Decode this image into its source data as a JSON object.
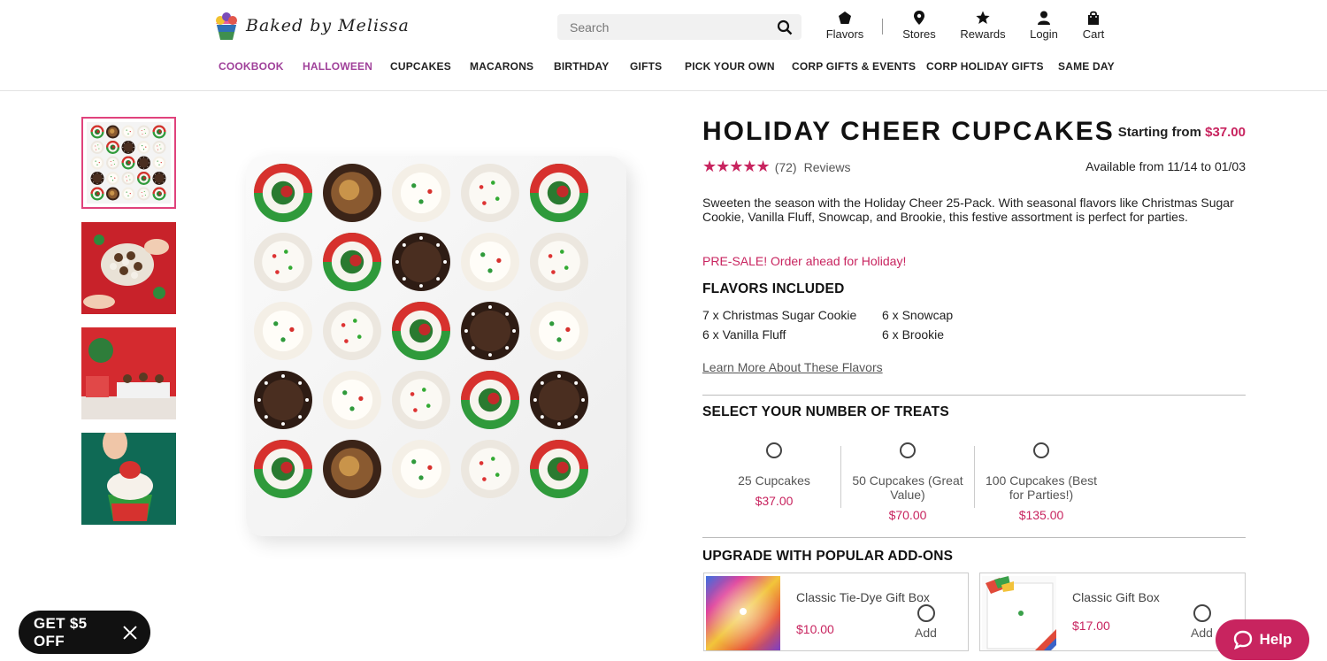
{
  "header": {
    "logo_text": "Baked by Melissa",
    "search_placeholder": "Search",
    "nav": [
      {
        "label": "Flavors",
        "icon": "flavors-icon"
      },
      {
        "label": "Stores",
        "icon": "map-pin-icon"
      },
      {
        "label": "Rewards",
        "icon": "star-icon"
      },
      {
        "label": "Login",
        "icon": "user-icon"
      },
      {
        "label": "Cart",
        "icon": "shopping-bag-icon"
      }
    ],
    "categories": [
      "COOKBOOK",
      "HALLOWEEN",
      "CUPCAKES",
      "MACARONS",
      "BIRTHDAY",
      "GIFTS",
      "PICK YOUR OWN",
      "CORP GIFTS & EVENTS",
      "CORP HOLIDAY GIFTS",
      "SAME DAY"
    ],
    "colors": {
      "accent_purple": "#a0419a",
      "accent_pink": "#c8245f"
    }
  },
  "product": {
    "title": "HOLIDAY CHEER CUPCAKES",
    "starting_label": "Starting from",
    "starting_price": "$37.00",
    "rating_stars": 5,
    "review_count": "(72)",
    "reviews_label": "Reviews",
    "availability": "Available from 11/14 to 01/03",
    "description": "Sweeten the season with the Holiday Cheer 25-Pack. With seasonal flavors like Christmas Sugar Cookie, Vanilla Fluff, Snowcap, and Brookie, this festive assortment is perfect for parties.",
    "presale": "PRE-SALE! Order ahead for Holiday!",
    "flavors_heading": "FLAVORS INCLUDED",
    "flavors": [
      "7 x Christmas Sugar Cookie",
      "6 x Snowcap",
      "6 x Vanilla Fluff",
      "6 x Brookie"
    ],
    "learn_more": "Learn More About These Flavors",
    "select_heading": "SELECT YOUR NUMBER OF TREATS",
    "options": [
      {
        "label": "25 Cupcakes",
        "price": "$37.00"
      },
      {
        "label": "50 Cupcakes (Great Value)",
        "price": "$70.00"
      },
      {
        "label": "100 Cupcakes (Best for Parties!)",
        "price": "$135.00"
      }
    ],
    "addons_heading": "UPGRADE WITH POPULAR ADD-ONS",
    "addons": [
      {
        "name": "Classic Tie-Dye Gift Box",
        "price": "$10.00",
        "action": "Add"
      },
      {
        "name": "Classic Gift Box",
        "price": "$17.00",
        "action": "Add"
      }
    ]
  },
  "promo": {
    "label": "GET $5 OFF",
    "close_icon": "close-icon"
  },
  "help": {
    "label": "Help",
    "icon": "chat-bubble-icon"
  }
}
